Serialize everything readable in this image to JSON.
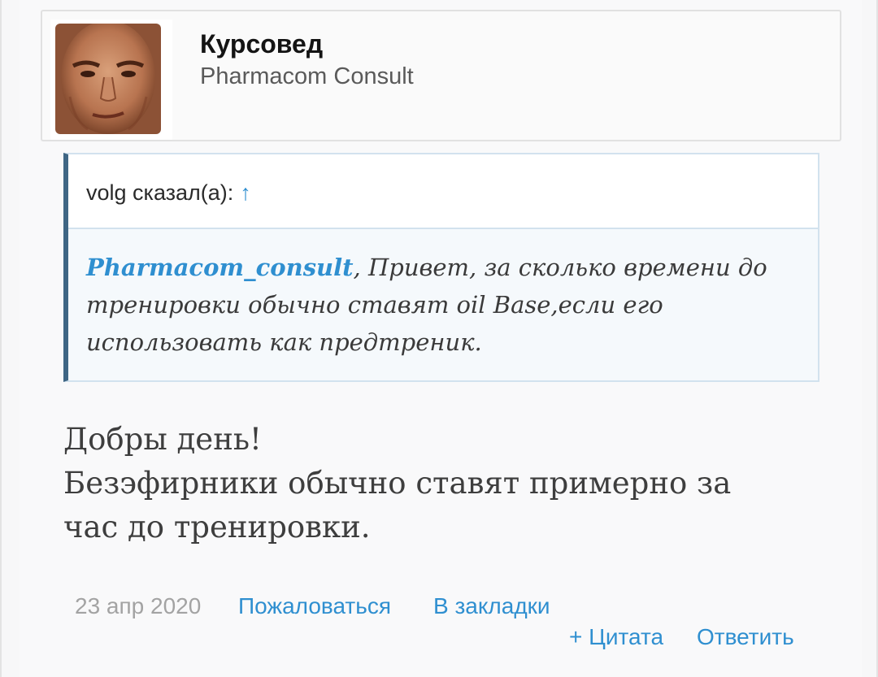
{
  "author": {
    "name": "Курсовед",
    "title": "Pharmacom Consult"
  },
  "quote": {
    "header": "volg сказал(а):",
    "arrow": "↑",
    "mention": "Pharmacom_consult",
    "text": ", Привет, за сколько времени до тренировки обычно ставят oil Base,если его использовать как предтреник."
  },
  "message": {
    "line1": "Добры день!",
    "line2": "Безэфирники обычно ставят примерно за",
    "line3": "час до тренировки."
  },
  "footer": {
    "date": "23 апр 2020",
    "report_label": "Пожаловаться",
    "bookmark_label": "В закладки",
    "quote_label": "+ Цитата",
    "reply_label": "Ответить"
  },
  "colors": {
    "link": "#2f8fd0",
    "quote_border": "#3f6684",
    "date": "#a3a3a3"
  }
}
